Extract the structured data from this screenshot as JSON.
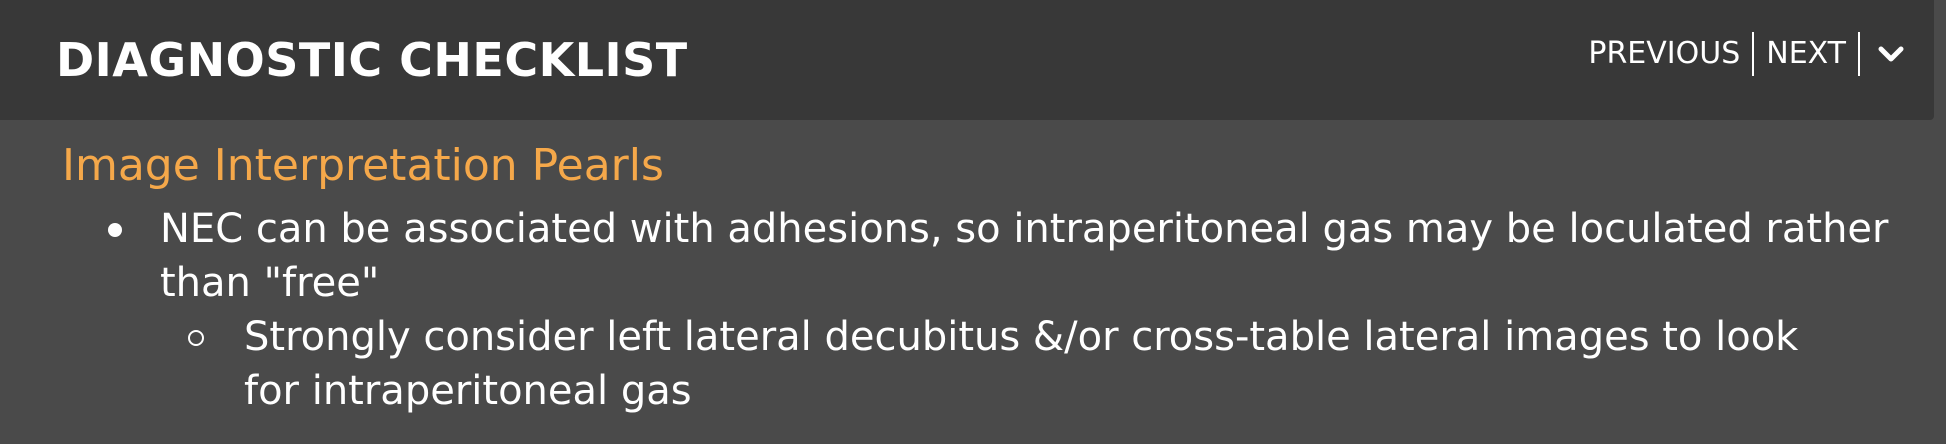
{
  "header": {
    "title": "DIAGNOSTIC CHECKLIST",
    "nav": {
      "previous_label": "PREVIOUS",
      "next_label": "NEXT",
      "toggle_icon": "chevron-down-icon"
    }
  },
  "section": {
    "title": "Image Interpretation Pearls",
    "items": [
      {
        "text": "NEC can be associated with adhesions, so intraperitoneal gas may be loculated rather than \"free\"",
        "subitems": [
          {
            "text": "Strongly consider left lateral decubitus &/or cross-table lateral images to look for intraperitoneal gas"
          }
        ]
      }
    ]
  },
  "colors": {
    "header_background": "#383838",
    "content_background": "#4a4a4a",
    "section_title": "#f5a84a",
    "text": "#ffffff"
  }
}
